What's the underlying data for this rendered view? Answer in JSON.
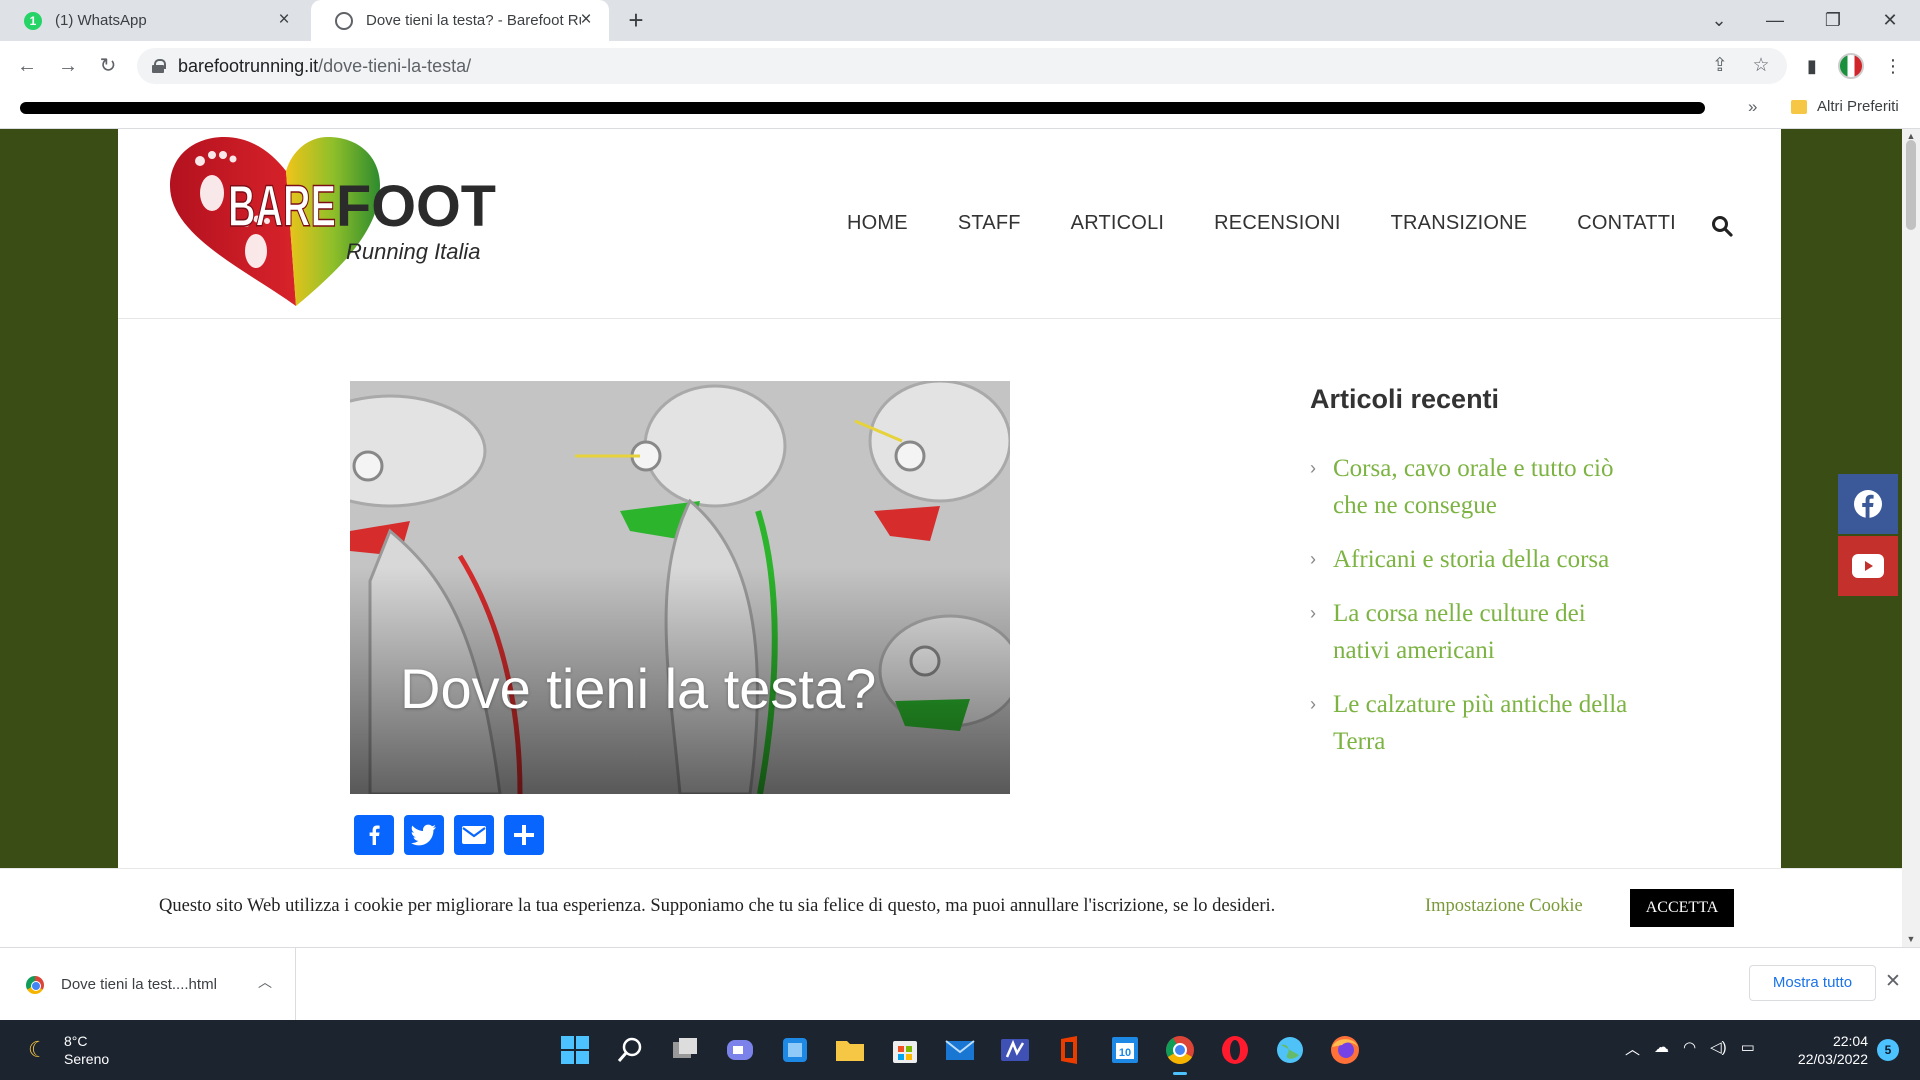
{
  "browser": {
    "tabs": [
      {
        "label": "(1) WhatsApp",
        "badge": "1",
        "active": false
      },
      {
        "label": "Dove tieni la testa? - Barefoot Running Italia",
        "active": true
      }
    ],
    "new_tab": "+",
    "window_controls": {
      "dropdown": "⌄",
      "minimize": "—",
      "restore": "❐",
      "close": "✕"
    },
    "url_host": "barefootrunning.it",
    "url_path": "/dove-tieni-la-testa/",
    "bookmarks_overflow": "»",
    "bookmarks_folder": "Altri Preferiti"
  },
  "site": {
    "logo": {
      "word_bare": "BARE",
      "word_foot": "FOOT",
      "tagline": "Running Italia"
    },
    "nav": [
      "HOME",
      "STAFF",
      "ARTICOLI",
      "RECENSIONI",
      "TRANSIZIONE",
      "CONTATTI"
    ],
    "hero_title": "Dove tieni la testa?",
    "sidebar": {
      "title": "Articoli recenti",
      "items": [
        "Corsa, cavo orale e tutto ciò che ne consegue",
        "Africani e storia della corsa",
        "La corsa nelle culture dei nativi americani",
        "Le calzature più antiche della Terra"
      ]
    },
    "cookie": {
      "text": "Questo sito Web utilizza i cookie per migliorare la tua esperienza. Supponiamo che tu sia felice di questo, ma puoi annullare l'iscrizione, se lo desideri.",
      "settings_label": "Impostazione Cookie",
      "accept_label": "ACCETTA"
    }
  },
  "downloads": {
    "file_name": "Dove tieni la test....html",
    "show_all_label": "Mostra tutto",
    "close": "✕"
  },
  "taskbar": {
    "temperature": "8°C",
    "condition": "Sereno",
    "time": "22:04",
    "date": "22/03/2022",
    "notifications": "5"
  },
  "colors": {
    "site_background": "#3a4d15",
    "link_green": "#7cb342",
    "facebook": "#3b5998",
    "youtube": "#c4302b",
    "share_blue": "#0866ff"
  }
}
